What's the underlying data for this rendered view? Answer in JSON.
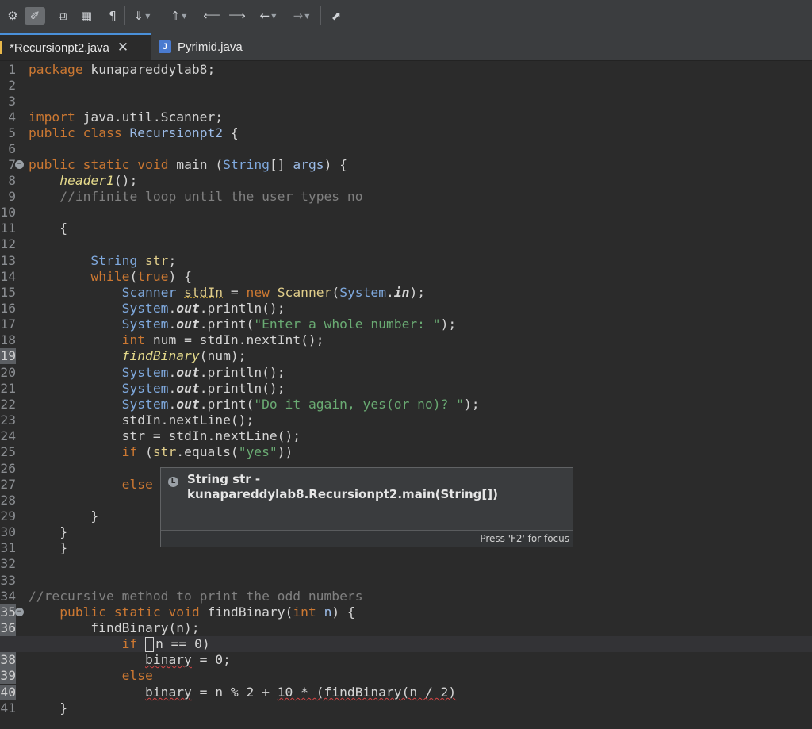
{
  "toolbar": {
    "items": [
      {
        "name": "debug-icon",
        "glyph": "⚙"
      },
      {
        "name": "mark-occurrences-icon",
        "glyph": "✐"
      },
      {
        "name": "new-window-icon",
        "glyph": "⧉"
      },
      {
        "name": "block-selection-icon",
        "glyph": "▦"
      },
      {
        "name": "show-whitespace-icon",
        "glyph": "¶"
      },
      {
        "name": "next-annotation-icon",
        "glyph": "⇓"
      },
      {
        "name": "previous-annotation-icon",
        "glyph": "⇑"
      },
      {
        "name": "last-edit-icon",
        "glyph": "⟸"
      },
      {
        "name": "forward-edit-icon",
        "glyph": "⟹"
      },
      {
        "name": "back-icon",
        "glyph": "←"
      },
      {
        "name": "forward-icon",
        "glyph": "→"
      },
      {
        "name": "pin-editor-icon",
        "glyph": "⬈"
      }
    ]
  },
  "tabs": [
    {
      "label": "*Recursionpt2.java",
      "close": "✕",
      "active": true
    },
    {
      "label": "Pyrimid.java",
      "icon": "J",
      "active": false
    }
  ],
  "gutter": {
    "line_numbers": [
      "1",
      "2",
      "3",
      "4",
      "5",
      "6",
      "7",
      "8",
      "9",
      "10",
      "11",
      "12",
      "13",
      "14",
      "15",
      "16",
      "17",
      "18",
      "19",
      "20",
      "21",
      "22",
      "23",
      "24",
      "25",
      "26",
      "27",
      "28",
      "29",
      "30",
      "31",
      "32",
      "33",
      "34",
      "35",
      "36",
      "37",
      "38",
      "39",
      "40",
      "41"
    ],
    "highlighted": [
      "19",
      "35",
      "36",
      "37",
      "38",
      "39",
      "40"
    ],
    "folds": {
      "7": "−",
      "35": "−"
    }
  },
  "code": {
    "l1": {
      "kw": "package",
      "rest": " kunapareddylab8;"
    },
    "l4": {
      "kw": "import",
      "rest": " java.util.Scanner;"
    },
    "l5": {
      "kw1": "public",
      "kw2": "class",
      "cls": "Recursionpt2",
      "rest": " {"
    },
    "l7": {
      "kw1": "public",
      "kw2": "static",
      "kw3": "void",
      "name": " main ",
      "p1": "(",
      "ty": "String",
      "p2": "[] ",
      "var": "args",
      "p3": ") {"
    },
    "l8": {
      "it": "header1",
      "rest": "();"
    },
    "l9": {
      "cm": "//infinite loop until the user types no"
    },
    "l11": {
      "rest": "{"
    },
    "l13": {
      "ty": "String",
      "var": " str",
      "rest": ";"
    },
    "l14": {
      "kw": "while",
      "p1": "(",
      "kw2": "true",
      "p2": ") {"
    },
    "l15": {
      "ty": "Scanner",
      "sp": " ",
      "var": "stdIn",
      "eq": " = ",
      "kw": "new",
      "sp2": " ",
      "ty2": "Scanner",
      "p1": "(",
      "ty3": "System",
      "dot": ".",
      "fld": "in",
      "p2": ");"
    },
    "l16": {
      "ty": "System",
      "dot": ".",
      "fld": "out",
      "rest": ".println();"
    },
    "l17": {
      "ty": "System",
      "dot": ".",
      "fld": "out",
      "m": ".print(",
      "str": "\"Enter a whole number: \"",
      "end": ");"
    },
    "l18": {
      "kw": "int",
      "rest": " num = stdIn.nextInt();"
    },
    "l19": {
      "it": "findBinary",
      "rest": "(num);"
    },
    "l20": {
      "ty": "System",
      "dot": ".",
      "fld": "out",
      "rest": ".println();"
    },
    "l21": {
      "ty": "System",
      "dot": ".",
      "fld": "out",
      "rest": ".println();"
    },
    "l22": {
      "ty": "System",
      "dot": ".",
      "fld": "out",
      "m": ".print(",
      "str": "\"Do it again, yes(or no)? \"",
      "end": ");"
    },
    "l23": {
      "rest": "stdIn.nextLine();"
    },
    "l24": {
      "rest": "str = stdIn.nextLine();"
    },
    "l25": {
      "kw": "if",
      "p1": " (",
      "var": "str",
      "m": ".equals(",
      "str": "\"yes\"",
      "end": "))"
    },
    "l27": {
      "kw": "else"
    },
    "l29": {
      "rest": "}"
    },
    "l30": {
      "rest": "}"
    },
    "l31": {
      "rest": "}"
    },
    "l34": {
      "cm": "//recursive method to print the odd numbers"
    },
    "l35": {
      "kw1": "public",
      "kw2": "static",
      "kw3": "void",
      "name": " findBinary(",
      "kw4": "int",
      "var": " n",
      "end": ") {"
    },
    "l36": {
      "rest": "findBinary(n);"
    },
    "l37": {
      "kw": "if",
      "sp": " ",
      "rest": "n == 0)"
    },
    "l38": {
      "err": "binary",
      "rest": " = 0;"
    },
    "l39": {
      "kw": "else"
    },
    "l40": {
      "err": "binary",
      "rest": " = n % 2 + ",
      "err2": "10 * (findBinary(n / 2)"
    },
    "l41": {
      "rest": "}"
    }
  },
  "popup": {
    "icon": "L",
    "line1": "String str -",
    "line2": "kunapareddylab8.Recursionpt2.main(String[])",
    "footer": "Press 'F2' for focus"
  }
}
